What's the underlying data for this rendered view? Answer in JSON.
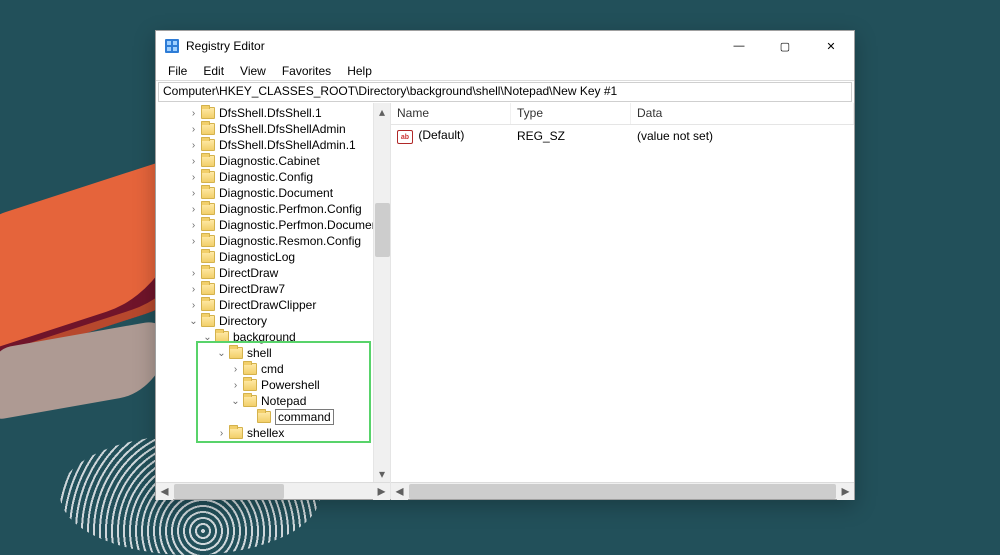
{
  "window": {
    "title": "Registry Editor"
  },
  "menubar": [
    "File",
    "Edit",
    "View",
    "Favorites",
    "Help"
  ],
  "address": "Computer\\HKEY_CLASSES_ROOT\\Directory\\background\\shell\\Notepad\\New Key #1",
  "tree": [
    {
      "indent": 2,
      "twist": "caret",
      "label": "DfsShell.DfsShell.1"
    },
    {
      "indent": 2,
      "twist": "caret",
      "label": "DfsShell.DfsShellAdmin"
    },
    {
      "indent": 2,
      "twist": "caret",
      "label": "DfsShell.DfsShellAdmin.1"
    },
    {
      "indent": 2,
      "twist": "caret",
      "label": "Diagnostic.Cabinet"
    },
    {
      "indent": 2,
      "twist": "caret",
      "label": "Diagnostic.Config"
    },
    {
      "indent": 2,
      "twist": "caret",
      "label": "Diagnostic.Document"
    },
    {
      "indent": 2,
      "twist": "caret",
      "label": "Diagnostic.Perfmon.Config"
    },
    {
      "indent": 2,
      "twist": "caret",
      "label": "Diagnostic.Perfmon.Document"
    },
    {
      "indent": 2,
      "twist": "caret",
      "label": "Diagnostic.Resmon.Config"
    },
    {
      "indent": 2,
      "twist": "none",
      "label": "DiagnosticLog"
    },
    {
      "indent": 2,
      "twist": "caret",
      "label": "DirectDraw"
    },
    {
      "indent": 2,
      "twist": "caret",
      "label": "DirectDraw7"
    },
    {
      "indent": 2,
      "twist": "caret",
      "label": "DirectDrawClipper"
    },
    {
      "indent": 2,
      "twist": "open",
      "label": "Directory"
    },
    {
      "indent": 3,
      "twist": "open",
      "label": "background"
    },
    {
      "indent": 4,
      "twist": "open",
      "label": "shell"
    },
    {
      "indent": 5,
      "twist": "caret",
      "label": "cmd"
    },
    {
      "indent": 5,
      "twist": "caret",
      "label": "Powershell"
    },
    {
      "indent": 5,
      "twist": "open",
      "label": "Notepad"
    },
    {
      "indent": 6,
      "twist": "none",
      "label": "command",
      "editing": true
    },
    {
      "indent": 4,
      "twist": "caret",
      "label": "shellex"
    }
  ],
  "list": {
    "headers": {
      "name": "Name",
      "type": "Type",
      "data": "Data"
    },
    "rows": [
      {
        "icon": "ab",
        "name": "(Default)",
        "type": "REG_SZ",
        "data": "(value not set)"
      }
    ]
  },
  "titlebar_buttons": {
    "min": "—",
    "max": "▢",
    "close": "✕"
  }
}
